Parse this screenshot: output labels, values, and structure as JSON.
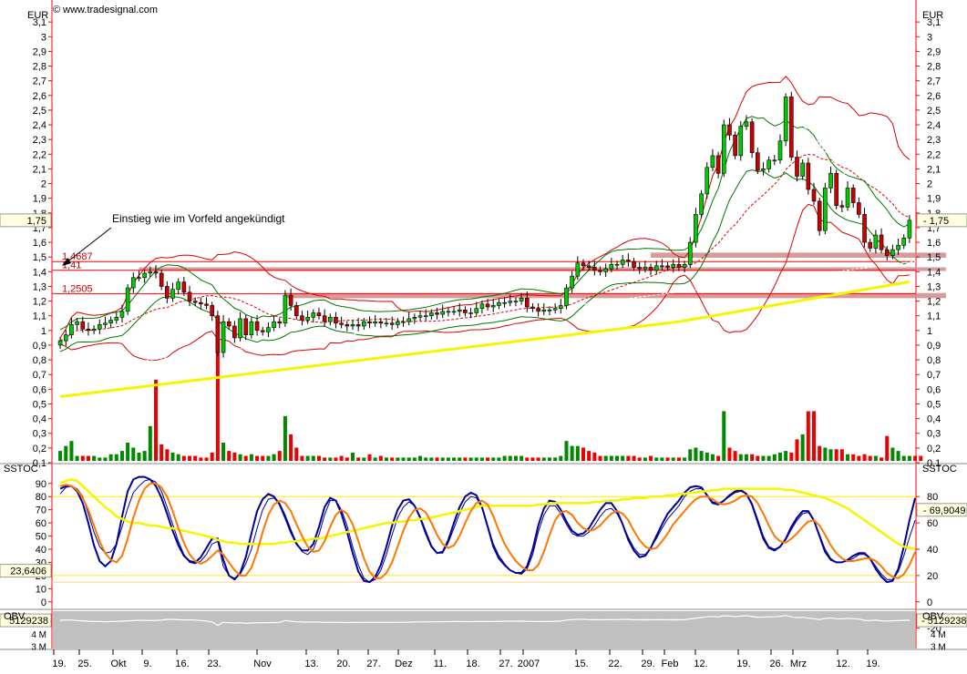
{
  "header": {
    "copyright": "© www.tradesignal.com",
    "currency_left": "EUR",
    "currency_right": "EUR"
  },
  "annotation": {
    "text": "Einstieg wie im Vorfeld angekündigt"
  },
  "colors": {
    "up_candle": "#00cc00",
    "down_candle": "#cc0000",
    "bollinger": "#dd0000",
    "envelope": "#007700",
    "sma_long": "#f5f500",
    "sstoc_k": "#000099",
    "sstoc_d": "#ff7700",
    "obv": "#ffffff",
    "resistance_band": "#d08a8a",
    "background": "#ffffff",
    "panel_grey": "#c0c0c0"
  },
  "chart_data": [
    {
      "type": "candlestick",
      "panel": "price",
      "y_unit": "EUR",
      "ylim": [
        0.1,
        3.2
      ],
      "y_ticks": [
        "3,1",
        "3",
        "2,9",
        "2,8",
        "2,7",
        "2,6",
        "2,5",
        "2,4",
        "2,3",
        "2,2",
        "2,1",
        "2",
        "1,9",
        "1,8",
        "1,7",
        "1,6",
        "1,5",
        "1,4",
        "1,3",
        "1,2",
        "1,1",
        "1",
        "0,9",
        "0,8",
        "0,7",
        "0,6",
        "0,5",
        "0,4",
        "0,3",
        "0,2",
        "0,1"
      ],
      "x_labels": [
        "19.",
        "25.",
        "Okt",
        "9.",
        "16.",
        "23.",
        "Nov",
        "13.",
        "20.",
        "27.",
        "Dez",
        "11.",
        "18.",
        "27.",
        "2007",
        "15.",
        "22.",
        "29.",
        "Feb",
        "12.",
        "19.",
        "26.",
        "Mrz",
        "12.",
        "19."
      ],
      "last_price_label": "1,75",
      "last_price": 1.75,
      "levels": [
        {
          "label": "1,4687",
          "value": 1.4687
        },
        {
          "label": "1,41",
          "value": 1.41
        },
        {
          "label": "1,2505",
          "value": 1.2505
        }
      ],
      "resistance_bands": [
        {
          "low": 1.495,
          "high": 1.53
        },
        {
          "low": 1.405,
          "high": 1.43
        },
        {
          "low": 1.22,
          "high": 1.255
        }
      ],
      "closes": [
        0.93,
        0.97,
        1.04,
        1.06,
        1.01,
        1.0,
        1.01,
        1.04,
        1.05,
        1.07,
        1.09,
        1.13,
        1.29,
        1.36,
        1.36,
        1.39,
        1.4,
        1.39,
        1.3,
        1.22,
        1.28,
        1.33,
        1.26,
        1.2,
        1.19,
        1.18,
        1.17,
        1.1,
        0.85,
        1.06,
        1.03,
        0.95,
        1.08,
        0.97,
        1.06,
        1.0,
        0.99,
        1.02,
        1.06,
        1.05,
        1.24,
        1.17,
        1.1,
        1.07,
        1.09,
        1.12,
        1.1,
        1.06,
        1.09,
        1.05,
        1.04,
        1.03,
        1.04,
        1.03,
        1.06,
        1.05,
        1.06,
        1.05,
        1.05,
        1.04,
        1.06,
        1.06,
        1.08,
        1.09,
        1.1,
        1.1,
        1.12,
        1.11,
        1.13,
        1.13,
        1.13,
        1.14,
        1.12,
        1.12,
        1.15,
        1.18,
        1.16,
        1.17,
        1.19,
        1.19,
        1.2,
        1.2,
        1.22,
        1.16,
        1.15,
        1.13,
        1.14,
        1.14,
        1.15,
        1.17,
        1.29,
        1.37,
        1.46,
        1.44,
        1.43,
        1.41,
        1.4,
        1.42,
        1.45,
        1.45,
        1.48,
        1.47,
        1.43,
        1.42,
        1.43,
        1.41,
        1.44,
        1.44,
        1.43,
        1.45,
        1.43,
        1.45,
        1.6,
        1.79,
        1.93,
        2.11,
        2.19,
        2.07,
        2.4,
        2.33,
        2.19,
        2.39,
        2.42,
        2.21,
        2.09,
        2.1,
        2.16,
        2.16,
        2.29,
        2.59,
        2.18,
        2.05,
        2.14,
        1.96,
        1.88,
        1.68,
        1.97,
        2.07,
        1.85,
        1.84,
        1.97,
        1.87,
        1.79,
        1.6,
        1.56,
        1.65,
        1.55,
        1.51,
        1.55,
        1.58,
        1.63,
        1.75
      ],
      "candle_count": 150,
      "volume_ylim": [
        0,
        0.55
      ],
      "volumes": [
        0.06,
        0.09,
        0.12,
        0.03,
        0.03,
        0.03,
        0.03,
        0.02,
        0.02,
        0.04,
        0.04,
        0.06,
        0.11,
        0.08,
        0.05,
        0.06,
        0.21,
        0.49,
        0.1,
        0.07,
        0.05,
        0.04,
        0.03,
        0.03,
        0.03,
        0.02,
        0.02,
        0.05,
        0.71,
        0.11,
        0.06,
        0.05,
        0.04,
        0.03,
        0.04,
        0.03,
        0.03,
        0.03,
        0.04,
        0.06,
        0.27,
        0.16,
        0.08,
        0.03,
        0.03,
        0.03,
        0.03,
        0.02,
        0.02,
        0.02,
        0.03,
        0.02,
        0.05,
        0.02,
        0.02,
        0.04,
        0.02,
        0.03,
        0.02,
        0.02,
        0.02,
        0.02,
        0.02,
        0.02,
        0.03,
        0.02,
        0.02,
        0.02,
        0.02,
        0.02,
        0.02,
        0.02,
        0.02,
        0.02,
        0.02,
        0.02,
        0.02,
        0.02,
        0.02,
        0.03,
        0.03,
        0.03,
        0.03,
        0.02,
        0.02,
        0.02,
        0.02,
        0.02,
        0.02,
        0.03,
        0.12,
        0.09,
        0.09,
        0.08,
        0.06,
        0.05,
        0.03,
        0.03,
        0.03,
        0.03,
        0.03,
        0.03,
        0.03,
        0.02,
        0.02,
        0.03,
        0.02,
        0.02,
        0.02,
        0.02,
        0.02,
        0.02,
        0.07,
        0.08,
        0.06,
        0.05,
        0.04,
        0.03,
        0.3,
        0.08,
        0.06,
        0.04,
        0.04,
        0.04,
        0.03,
        0.03,
        0.03,
        0.04,
        0.05,
        0.06,
        0.05,
        0.13,
        0.16,
        0.3,
        0.3,
        0.09,
        0.08,
        0.07,
        0.07,
        0.07,
        0.04,
        0.04,
        0.03,
        0.04,
        0.03,
        0.03,
        0.02,
        0.15,
        0.08,
        0.06,
        0.03,
        0.03,
        0.03,
        0.03
      ]
    },
    {
      "type": "line",
      "panel": "oscillator",
      "indicator": "SSTOC",
      "ylim": [
        -5,
        103
      ],
      "y_ticks": [
        "90",
        "80",
        "70",
        "60",
        "50",
        "40",
        "30",
        "20",
        "10",
        "0"
      ],
      "right_ticks": [
        "80",
        "60",
        "40",
        "20",
        "0",
        "-20"
      ],
      "reference_lines": [
        80,
        20,
        15
      ],
      "current_value_right": "69,9049",
      "current_value_left": "23,6406",
      "series": [
        {
          "values": [
            82,
            87,
            88,
            86,
            80,
            67,
            53,
            42,
            37,
            38,
            44,
            57,
            71,
            83,
            88,
            92,
            93,
            91,
            84,
            72,
            59,
            46,
            36,
            30,
            29,
            31,
            36,
            44,
            46,
            27,
            20,
            18,
            21,
            29,
            40,
            56,
            70,
            78,
            79,
            75,
            66,
            55,
            45,
            38,
            36,
            40,
            51,
            66,
            77,
            77,
            70,
            58,
            42,
            28,
            18,
            15,
            17,
            24,
            36,
            51,
            64,
            72,
            76,
            73,
            65,
            54,
            43,
            37,
            37,
            45,
            56,
            67,
            76,
            80,
            79,
            71,
            58,
            44,
            35,
            29,
            24,
            22,
            21,
            25,
            36,
            53,
            66,
            73,
            73,
            67,
            59,
            52,
            50,
            50,
            53,
            58,
            65,
            70,
            71,
            67,
            59,
            49,
            41,
            36,
            36,
            41,
            48,
            56,
            63,
            68,
            73,
            80,
            84,
            86,
            86,
            81,
            76,
            75,
            77,
            80,
            83,
            84,
            82,
            75,
            63,
            50,
            42,
            40,
            42,
            47,
            55,
            62,
            67,
            68,
            62,
            51,
            40,
            33,
            30,
            30,
            31,
            33,
            36,
            36,
            33,
            27,
            21,
            17,
            17,
            23,
            35,
            49,
            62
          ]
        },
        {
          "values": [
            86,
            88,
            88,
            84,
            75,
            60,
            43,
            31,
            27,
            31,
            44,
            65,
            84,
            93,
            95,
            95,
            93,
            88,
            79,
            67,
            54,
            43,
            35,
            31,
            30,
            34,
            41,
            48,
            48,
            32,
            20,
            17,
            22,
            34,
            52,
            69,
            78,
            82,
            80,
            74,
            64,
            53,
            44,
            39,
            39,
            44,
            57,
            72,
            79,
            77,
            67,
            53,
            37,
            23,
            16,
            15,
            19,
            28,
            42,
            58,
            70,
            77,
            78,
            73,
            64,
            52,
            42,
            37,
            38,
            47,
            60,
            72,
            80,
            83,
            81,
            72,
            57,
            42,
            33,
            28,
            24,
            22,
            22,
            27,
            40,
            58,
            71,
            77,
            76,
            70,
            61,
            54,
            51,
            52,
            56,
            63,
            70,
            75,
            75,
            69,
            59,
            47,
            39,
            34,
            35,
            41,
            50,
            59,
            67,
            72,
            77,
            83,
            87,
            88,
            87,
            81,
            75,
            74,
            77,
            81,
            84,
            85,
            82,
            74,
            61,
            48,
            41,
            39,
            42,
            48,
            57,
            64,
            69,
            69,
            62,
            50,
            38,
            32,
            30,
            30,
            32,
            35,
            37,
            37,
            33,
            25,
            19,
            15,
            16,
            25,
            42,
            62,
            79
          ]
        },
        {
          "values": [
            90,
            92,
            93,
            92,
            88,
            84,
            80,
            76,
            72,
            69,
            65,
            63,
            61,
            60,
            60,
            59,
            58,
            58,
            57,
            56,
            56,
            55,
            54,
            53,
            52,
            51,
            50,
            49,
            47,
            46,
            45,
            45,
            44,
            44,
            44,
            44,
            44,
            44,
            44,
            45,
            45,
            46,
            46,
            47,
            47,
            48,
            48,
            49,
            50,
            51,
            52,
            53,
            54,
            55,
            56,
            57,
            58,
            59,
            60,
            60,
            61,
            61,
            62,
            62,
            63,
            63,
            64,
            65,
            66,
            67,
            68,
            69,
            70,
            71,
            72,
            73,
            73,
            73,
            73,
            73,
            73,
            73,
            73,
            73,
            73,
            74,
            74,
            75,
            75,
            75,
            75,
            75,
            75,
            75,
            75,
            76,
            76,
            77,
            77,
            77,
            78,
            78,
            79,
            79,
            79,
            80,
            80,
            80,
            81,
            81,
            82,
            82,
            83,
            83,
            84,
            84,
            85,
            85,
            86,
            86,
            86,
            86,
            86,
            86,
            86,
            86,
            86,
            86,
            86,
            85,
            85,
            84,
            83,
            82,
            81,
            80,
            79,
            77,
            75,
            73,
            71,
            68,
            65,
            62,
            59,
            56,
            53,
            50,
            47,
            44,
            42,
            41,
            40
          ]
        },
        {
          "values": [
            88,
            89,
            88,
            85,
            79,
            70,
            58,
            46,
            37,
            32,
            30,
            35,
            48,
            64,
            77,
            86,
            90,
            90,
            87,
            80,
            69,
            56,
            45,
            36,
            31,
            29,
            31,
            35,
            39,
            36,
            30,
            24,
            20,
            20,
            26,
            38,
            53,
            66,
            74,
            77,
            75,
            69,
            59,
            50,
            42,
            38,
            39,
            46,
            57,
            66,
            70,
            67,
            59,
            46,
            33,
            23,
            18,
            18,
            22,
            30,
            42,
            54,
            64,
            70,
            71,
            68,
            60,
            51,
            44,
            41,
            43,
            50,
            60,
            69,
            75,
            77,
            74,
            65,
            54,
            44,
            37,
            31,
            27,
            24,
            24,
            28,
            38,
            51,
            62,
            68,
            69,
            66,
            60,
            56,
            54,
            55,
            58,
            63,
            67,
            69,
            67,
            62,
            54,
            47,
            42,
            40,
            41,
            46,
            52,
            59,
            64,
            69,
            74,
            78,
            80,
            80,
            78,
            75,
            74,
            75,
            77,
            80,
            81,
            80,
            75,
            67,
            58,
            50,
            46,
            45,
            48,
            52,
            57,
            61,
            62,
            58,
            51,
            43,
            37,
            33,
            31,
            31,
            32,
            33,
            33,
            31,
            27,
            22,
            19,
            18,
            21,
            28,
            38
          ]
        }
      ]
    },
    {
      "type": "area",
      "panel": "volume_indicator",
      "indicator": "OBV",
      "current_value": "5129238",
      "left_value": "5129238",
      "y_ticks": [
        "5 M",
        "4 M",
        "3 M"
      ],
      "values": [
        5.12,
        5.15,
        5.14,
        5.1,
        5.08,
        5.05,
        5.03,
        5.02,
        5.0,
        5.02,
        5.03,
        5.05,
        5.08,
        5.1,
        5.12,
        5.11,
        5.1,
        5.12,
        5.14,
        5.2,
        5.19,
        5.17,
        5.15,
        5.16,
        5.14,
        5.1,
        5.06,
        4.98,
        4.7,
        4.95,
        4.93,
        4.9,
        4.92,
        4.88,
        4.9,
        4.91,
        4.92,
        4.93,
        4.94,
        4.95,
        5.1,
        5.05,
        5.0,
        4.98,
        4.97,
        4.98,
        4.97,
        4.95,
        4.97,
        4.96,
        4.95,
        4.94,
        4.95,
        4.94,
        4.95,
        4.96,
        4.95,
        4.96,
        4.95,
        4.95,
        4.96,
        4.96,
        4.97,
        4.98,
        4.99,
        4.99,
        5.0,
        5.0,
        5.01,
        5.01,
        5.02,
        5.02,
        5.01,
        5.01,
        5.02,
        5.03,
        5.02,
        5.03,
        5.04,
        5.04,
        5.05,
        5.05,
        5.06,
        5.04,
        5.03,
        5.02,
        5.02,
        5.03,
        5.04,
        5.06,
        5.14,
        5.18,
        5.21,
        5.2,
        5.18,
        5.17,
        5.16,
        5.17,
        5.18,
        5.18,
        5.19,
        5.19,
        5.17,
        5.16,
        5.17,
        5.16,
        5.17,
        5.17,
        5.16,
        5.17,
        5.16,
        5.17,
        5.24,
        5.3,
        5.35,
        5.41,
        5.44,
        5.4,
        5.5,
        5.47,
        5.42,
        5.48,
        5.5,
        5.43,
        5.38,
        5.39,
        5.41,
        5.41,
        5.45,
        5.52,
        5.4,
        5.34,
        5.37,
        5.3,
        5.25,
        5.18,
        5.28,
        5.31,
        5.25,
        5.24,
        5.28,
        5.25,
        5.22,
        5.12,
        5.1,
        5.13,
        5.08,
        5.06,
        5.08,
        5.1,
        5.12,
        5.13
      ]
    }
  ]
}
